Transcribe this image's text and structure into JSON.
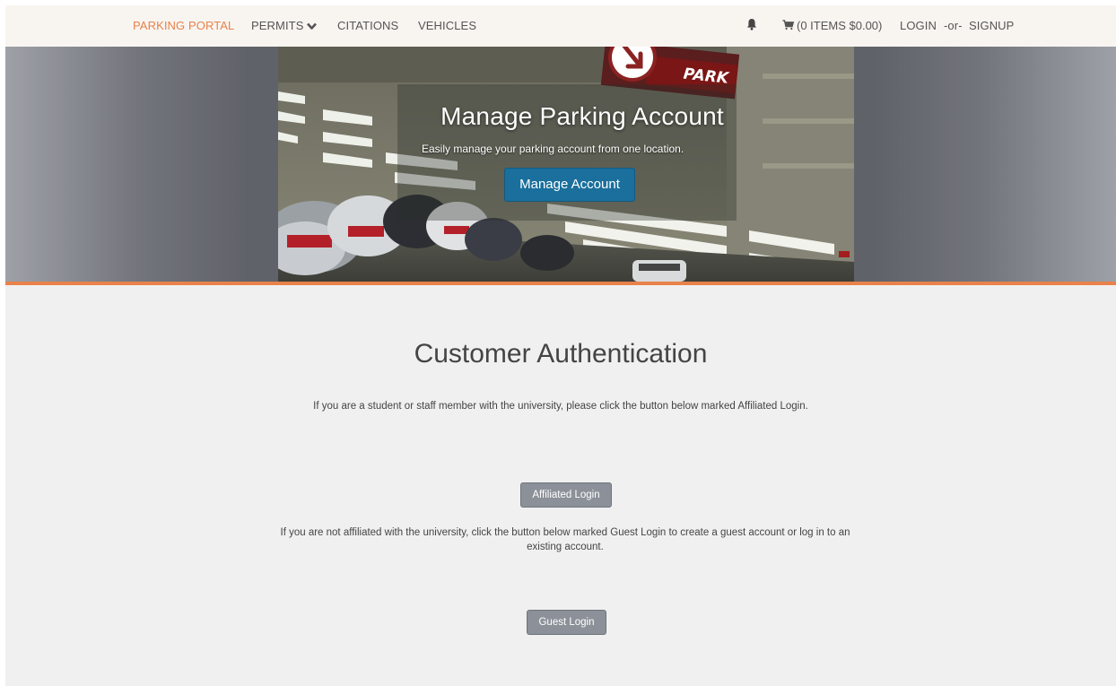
{
  "navbar": {
    "brand": "PARKING PORTAL",
    "items": [
      {
        "label": "PERMITS"
      },
      {
        "label": "CITATIONS"
      },
      {
        "label": "VEHICLES"
      }
    ],
    "cart_label": "(0 ITEMS $0.00)",
    "login_label": "LOGIN",
    "or_label": "-or-",
    "signup_label": "SIGNUP",
    "icons": {
      "permits_dropdown": "chevron-down-icon",
      "notifications": "bell-icon",
      "cart": "cart-icon"
    }
  },
  "hero": {
    "title": "Manage Parking Account",
    "subtitle": "Easily manage your parking account from one location.",
    "button_label": "Manage Account",
    "sign_text": "PARK"
  },
  "main": {
    "title": "Customer Authentication",
    "affiliated_text": "If you are a student or staff member with the university, please click the button below marked Affiliated Login.",
    "affiliated_button": "Affiliated Login",
    "guest_text": "If you are not affiliated with the university, click the button below marked Guest Login to create a guest account or log in to an existing account.",
    "guest_button": "Guest Login"
  },
  "colors": {
    "brand": "#e8824a",
    "primary_button": "#1a6f9c",
    "secondary_button": "#8c9199",
    "accent_line": "#e8824a"
  }
}
